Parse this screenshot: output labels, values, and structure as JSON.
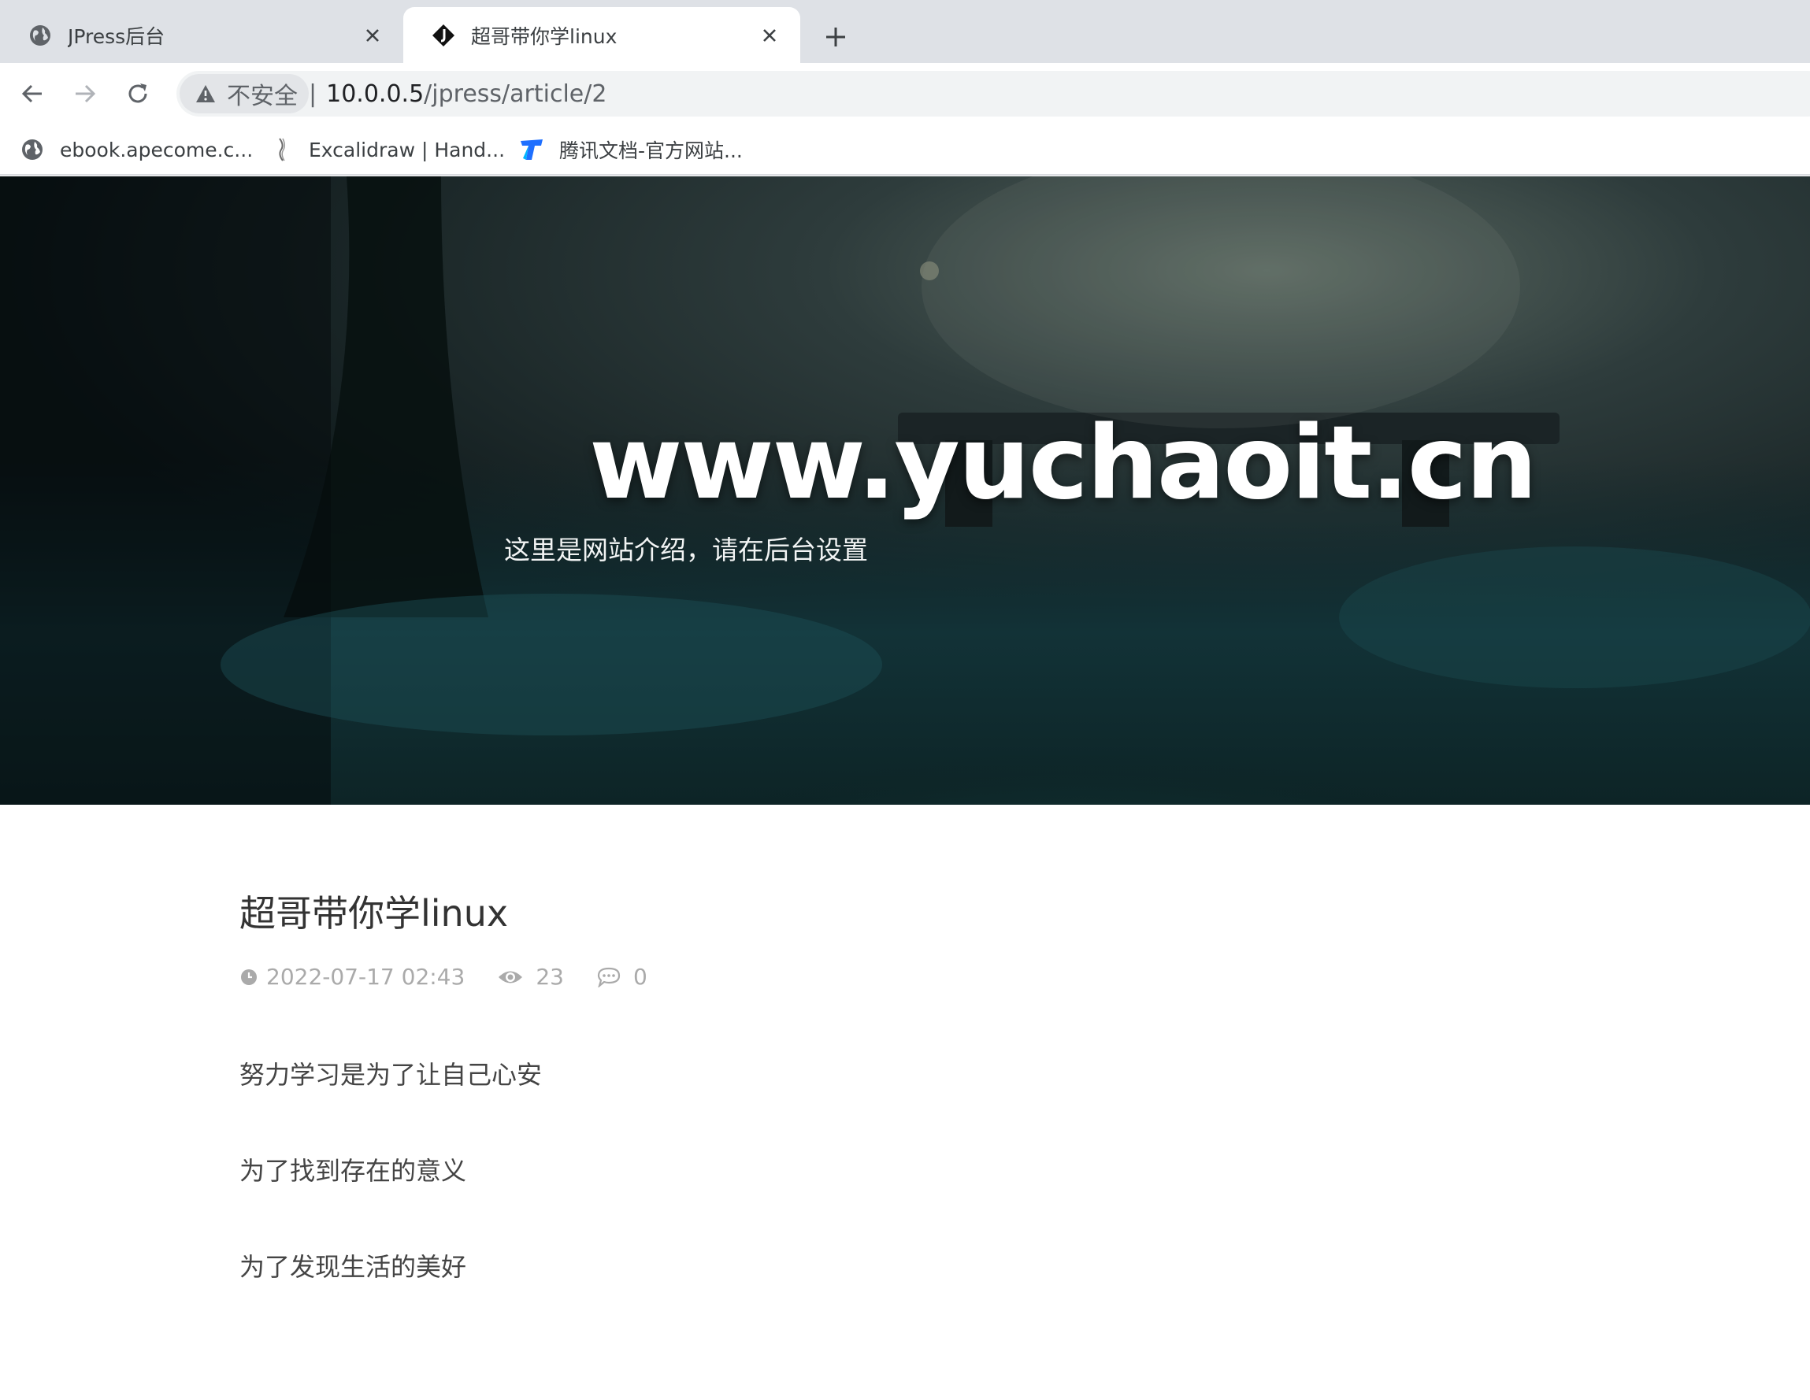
{
  "browser": {
    "tabs": [
      {
        "title": "JPress后台",
        "favicon": "globe-icon",
        "active": false
      },
      {
        "title": "超哥带你学linux",
        "favicon": "jpress-logo-icon",
        "active": true
      }
    ],
    "address": {
      "security_label": "不安全",
      "separator": "|",
      "url_host": "10.0.0.5",
      "url_path": "/jpress/article/2"
    },
    "bookmarks": [
      {
        "label": "ebook.apecome.c...",
        "icon": "globe-icon"
      },
      {
        "label": "Excalidraw | Hand...",
        "icon": "excalidraw-icon"
      },
      {
        "label": "腾讯文档-官方网站...",
        "icon": "tencent-docs-icon"
      }
    ]
  },
  "hero": {
    "site_title": "www.yuchaoit.cn",
    "site_description": "这里是网站介绍，请在后台设置"
  },
  "article": {
    "title": "超哥带你学linux",
    "date": "2022-07-17 02:43",
    "views": "23",
    "comments": "0",
    "paragraphs": [
      "努力学习是为了让自己心安",
      "为了找到存在的意义",
      "为了发现生活的美好"
    ]
  }
}
